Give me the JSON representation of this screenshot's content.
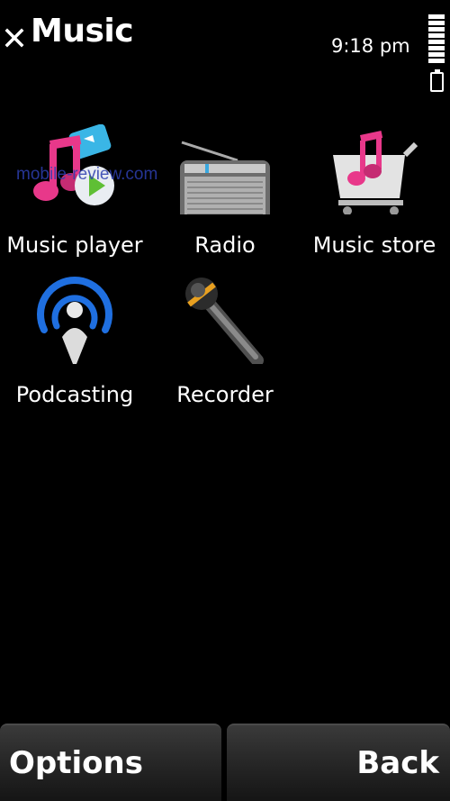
{
  "header": {
    "title": "Music",
    "close_icon": "close-icon"
  },
  "status": {
    "time": "9:18 pm",
    "signal_icon": "signal-bars-icon",
    "battery_icon": "battery-icon"
  },
  "apps": [
    {
      "label": "Music player",
      "icon": "music-player-icon"
    },
    {
      "label": "Radio",
      "icon": "radio-icon"
    },
    {
      "label": "Music store",
      "icon": "music-store-icon"
    },
    {
      "label": "Podcasting",
      "icon": "podcasting-icon"
    },
    {
      "label": "Recorder",
      "icon": "recorder-icon"
    }
  ],
  "watermark": "mobile-review.com",
  "softkeys": {
    "left_label": "Options",
    "right_label": "Back"
  },
  "colors": {
    "background": "#000000",
    "accent_pink": "#e6357f",
    "accent_blue": "#1f6fe0"
  }
}
